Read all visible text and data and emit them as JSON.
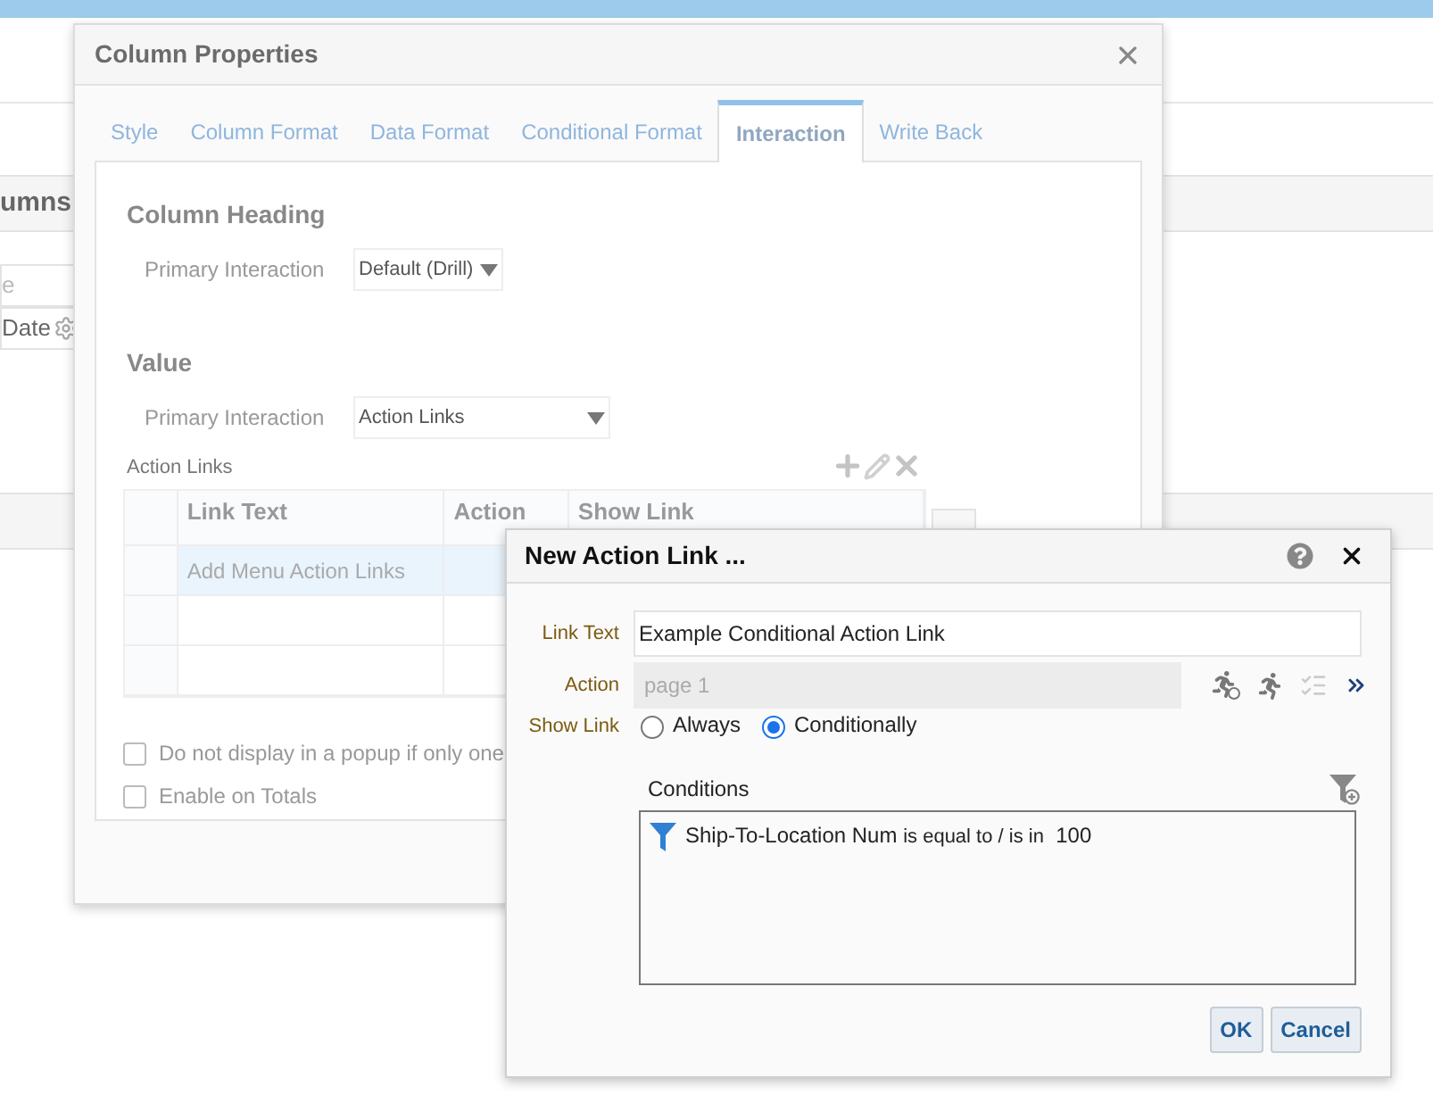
{
  "background": {
    "section_title": "umns",
    "items": [
      {
        "label": "e"
      },
      {
        "label": "Date"
      }
    ]
  },
  "column_properties": {
    "title": "Column Properties",
    "tabs": [
      {
        "label": "Style",
        "selected": false
      },
      {
        "label": "Column Format",
        "selected": false
      },
      {
        "label": "Data Format",
        "selected": false
      },
      {
        "label": "Conditional Format",
        "selected": false
      },
      {
        "label": "Interaction",
        "selected": true
      },
      {
        "label": "Write Back",
        "selected": false
      }
    ],
    "column_heading": {
      "title": "Column Heading",
      "primary_interaction": {
        "label": "Primary Interaction",
        "value": "Default (Drill)"
      }
    },
    "value": {
      "title": "Value",
      "primary_interaction": {
        "label": "Primary Interaction",
        "value": "Action Links"
      }
    },
    "action_links": {
      "title": "Action Links",
      "columns": [
        "Link Text",
        "Action",
        "Show Link"
      ],
      "rows": [
        {
          "link_text": "Add Menu Action Links",
          "selected": true
        },
        {
          "selected": false
        },
        {
          "selected": false
        }
      ]
    },
    "options": [
      {
        "label": "Do not display in a popup if only one",
        "checked": false
      },
      {
        "label": "Enable on Totals",
        "checked": false
      }
    ]
  },
  "new_action_link": {
    "title": "New Action Link ...",
    "link_text": {
      "label": "Link Text",
      "value": "Example Conditional Action Link"
    },
    "action": {
      "label": "Action",
      "value": "page 1",
      "disabled": true
    },
    "show_link": {
      "label": "Show Link",
      "options": [
        {
          "label": "Always",
          "selected": false
        },
        {
          "label": "Conditionally",
          "selected": true
        }
      ]
    },
    "conditions": {
      "title": "Conditions",
      "items": [
        {
          "column": "Ship-To-Location Num",
          "operator": "is equal to / is in",
          "value": "100"
        }
      ]
    },
    "buttons": [
      "OK",
      "Cancel"
    ]
  }
}
